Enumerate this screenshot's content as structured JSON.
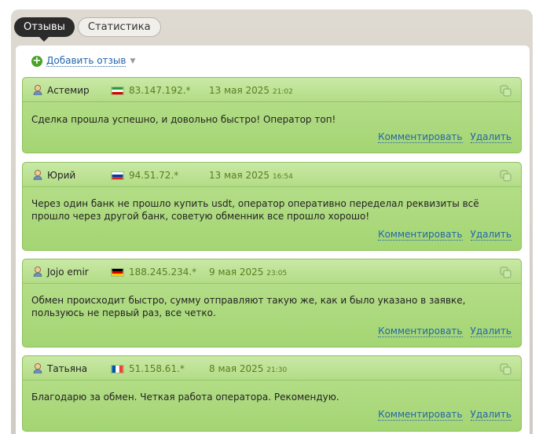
{
  "tabs": [
    {
      "label": "Отзывы",
      "active": true
    },
    {
      "label": "Статистика",
      "active": false
    }
  ],
  "add_review": {
    "label": "Добавить отзыв",
    "icon": "plus-circle-icon"
  },
  "action_labels": {
    "comment": "Комментировать",
    "delete": "Удалить"
  },
  "colors": {
    "accent_green": "#4aa328",
    "card_green": "#b3dc86",
    "link_blue": "#2266aa",
    "meta_green": "#5a7d1e"
  },
  "reviews": [
    {
      "name": "Астемир",
      "flag": "Iran",
      "ip": "83.147.192.*",
      "date": "13 мая 2025",
      "time": "21:02",
      "text": "Сделка прошла успешно, и довольно быстро! Оператор топ!"
    },
    {
      "name": "Юрий",
      "flag": "Russia",
      "ip": "94.51.72.*",
      "date": "13 мая 2025",
      "time": "16:54",
      "text": "Через один банк не прошло купить usdt, оператор оперативно переделал реквизиты всё прошло через другой банк, советую обменник все прошло хорошо!"
    },
    {
      "name": "Jojo emir",
      "flag": "Germany",
      "ip": "188.245.234.*",
      "date": "9 мая 2025",
      "time": "23:05",
      "text": "Обмен происходит быстро, сумму отправляют такую же, как и было указано в заявке, пользуюсь не первый раз, все четко."
    },
    {
      "name": "Татьяна",
      "flag": "France",
      "ip": "51.158.61.*",
      "date": "8 мая 2025",
      "time": "21:30",
      "text": "Благодарю за обмен. Четкая работа оператора. Рекомендую."
    }
  ]
}
